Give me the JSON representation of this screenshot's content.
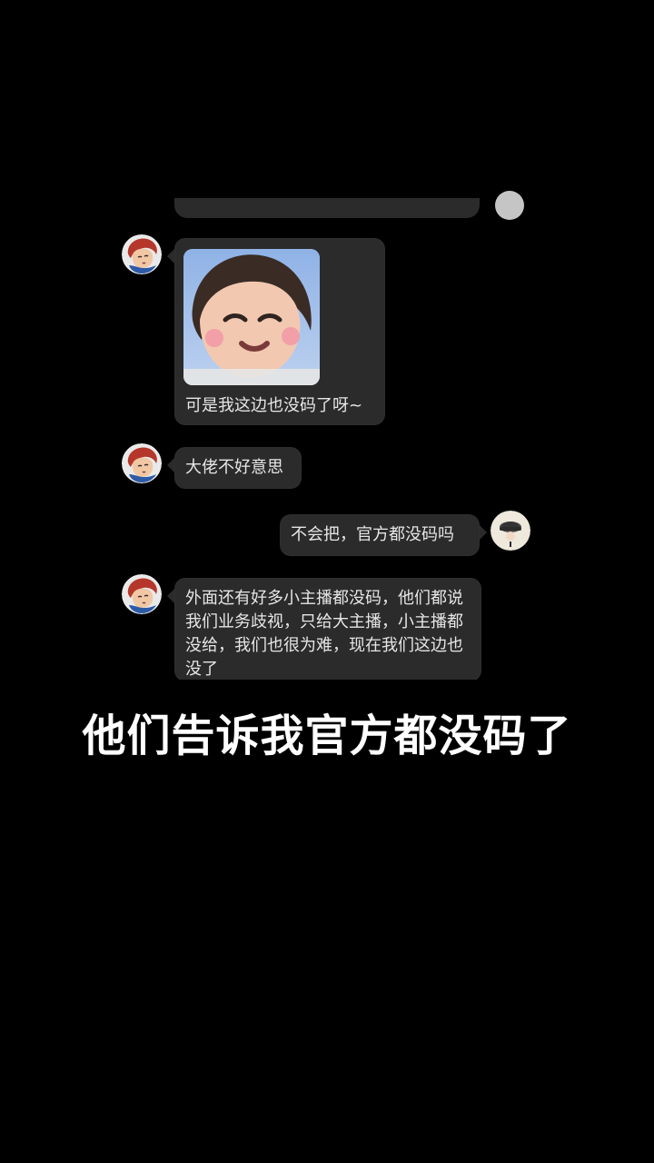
{
  "messages": [
    {
      "sender": "other",
      "image": "baby-face-sticker",
      "text": "可是我这边也没码了呀~"
    },
    {
      "sender": "other",
      "text": "大佬不好意思"
    },
    {
      "sender": "self",
      "text": "不会把，官方都没码吗"
    },
    {
      "sender": "other",
      "text": "外面还有好多小主播都没码，他们都说我们业务歧视，只给大主播，小主播都没给，我们也很为难，现在我们这边也没了"
    }
  ],
  "caption": "他们告诉我官方都没码了",
  "colors": {
    "background": "#000000",
    "bubble": "#2b2b2b",
    "text": "#e6e6e6",
    "caption": "#ffffff"
  },
  "icons": {
    "other_avatar": "anime-girl-red-hair-avatar",
    "self_avatar": "bowler-hat-avatar"
  }
}
